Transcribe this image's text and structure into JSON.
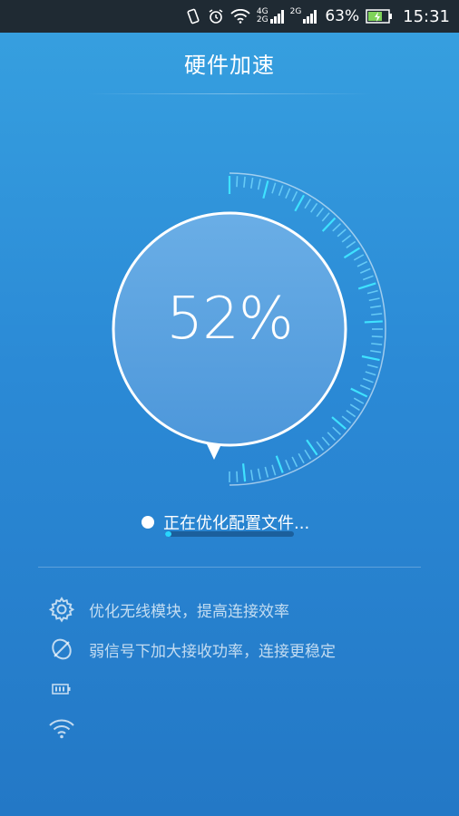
{
  "status_bar": {
    "network_labels": [
      "4G",
      "2G"
    ],
    "network2_label": "2G",
    "battery_percent": "63%",
    "time": "15:31"
  },
  "header": {
    "title": "硬件加速"
  },
  "gauge": {
    "percent_text": "52%"
  },
  "progress": {
    "label": "正在优化配置文件...",
    "fraction": 0.05
  },
  "optimization_items": [
    {
      "icon": "gear-icon",
      "label": "优化无线模块，提高连接效率"
    },
    {
      "icon": "signal-icon",
      "label": "弱信号下加大接收功率，连接更稳定"
    },
    {
      "icon": "battery-icon",
      "label": ""
    },
    {
      "icon": "wifi-icon",
      "label": ""
    }
  ],
  "colors": {
    "accent": "#28d6ff",
    "track": "#1b5f9c",
    "background_top": "#37a1e0",
    "background_bottom": "#2378c6"
  }
}
